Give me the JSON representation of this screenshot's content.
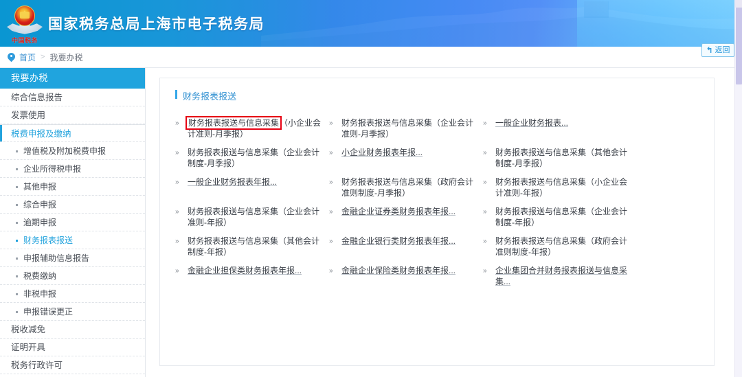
{
  "header": {
    "site_title": "国家税务总局上海市电子税务局",
    "emblem_text": "中国税务",
    "emblem_name": "tax-bureau-emblem"
  },
  "breadcrumb": {
    "pin_icon": "location-pin-icon",
    "home": "首页",
    "separator": ">",
    "current": "我要办税"
  },
  "toolbar": {
    "return_icon": "↰",
    "return_label": "返回"
  },
  "sidebar": {
    "heading": "我要办税",
    "items": [
      {
        "label": "综合信息报告",
        "level": 1,
        "state": "normal"
      },
      {
        "label": "发票使用",
        "level": 1,
        "state": "normal"
      },
      {
        "label": "税费申报及缴纳",
        "level": 1,
        "state": "active"
      },
      {
        "label": "增值税及附加税费申报",
        "level": 2,
        "state": "normal"
      },
      {
        "label": "企业所得税申报",
        "level": 2,
        "state": "normal"
      },
      {
        "label": "其他申报",
        "level": 2,
        "state": "normal"
      },
      {
        "label": "综合申报",
        "level": 2,
        "state": "normal"
      },
      {
        "label": "逾期申报",
        "level": 2,
        "state": "normal"
      },
      {
        "label": "财务报表报送",
        "level": 2,
        "state": "current"
      },
      {
        "label": "申报辅助信息报告",
        "level": 2,
        "state": "normal"
      },
      {
        "label": "税费缴纳",
        "level": 2,
        "state": "normal"
      },
      {
        "label": "非税申报",
        "level": 2,
        "state": "normal"
      },
      {
        "label": "申报错误更正",
        "level": 2,
        "state": "normal"
      },
      {
        "label": "税收减免",
        "level": 1,
        "state": "normal"
      },
      {
        "label": "证明开具",
        "level": 1,
        "state": "normal"
      },
      {
        "label": "税务行政许可",
        "level": 1,
        "state": "normal"
      }
    ]
  },
  "main": {
    "panel_title": "财务报表报送",
    "chevron_icon": "»",
    "links": [
      {
        "text": "财务报表报送与信息采集（小企业会计准则-月季报）",
        "highlight_prefix": "财务报表报送与信息采集",
        "highlighted": true,
        "underline": false
      },
      {
        "text": "财务报表报送与信息采集（企业会计准则-月季报）",
        "highlighted": false,
        "underline": false
      },
      {
        "text": "一般企业财务报表...",
        "highlighted": false,
        "underline": true
      },
      {
        "text": "财务报表报送与信息采集（企业会计制度-月季报）",
        "highlighted": false,
        "underline": false
      },
      {
        "text": "小企业财务报表年报...",
        "highlighted": false,
        "underline": true
      },
      {
        "text": "财务报表报送与信息采集（其他会计制度-月季报）",
        "highlighted": false,
        "underline": false
      },
      {
        "text": "一般企业财务报表年报...",
        "highlighted": false,
        "underline": true
      },
      {
        "text": "财务报表报送与信息采集（政府会计准则制度-月季报）",
        "highlighted": false,
        "underline": false
      },
      {
        "text": "财务报表报送与信息采集（小企业会计准则-年报）",
        "highlighted": false,
        "underline": false
      },
      {
        "text": "财务报表报送与信息采集（企业会计准则-年报）",
        "highlighted": false,
        "underline": false
      },
      {
        "text": "金融企业证券类财务报表年报...",
        "highlighted": false,
        "underline": true
      },
      {
        "text": "财务报表报送与信息采集（企业会计制度-年报）",
        "highlighted": false,
        "underline": false
      },
      {
        "text": "财务报表报送与信息采集（其他会计制度-年报）",
        "highlighted": false,
        "underline": false
      },
      {
        "text": "金融企业银行类财务报表年报...",
        "highlighted": false,
        "underline": true
      },
      {
        "text": "财务报表报送与信息采集（政府会计准则制度-年报）",
        "highlighted": false,
        "underline": false
      },
      {
        "text": "金融企业担保类财务报表年报...",
        "highlighted": false,
        "underline": true
      },
      {
        "text": "金融企业保险类财务报表年报...",
        "highlighted": false,
        "underline": true
      },
      {
        "text": "企业集团合并财务报表报送与信息采集...",
        "highlighted": false,
        "underline": true
      }
    ]
  },
  "colors": {
    "brand_blue": "#20a4de",
    "header_blue": "#2f8fe6",
    "link_blue": "#2f9bdc",
    "highlight_red": "#e60012",
    "text_dark": "#3b4048"
  },
  "scrollbar": {
    "name": "page-scrollbar"
  }
}
